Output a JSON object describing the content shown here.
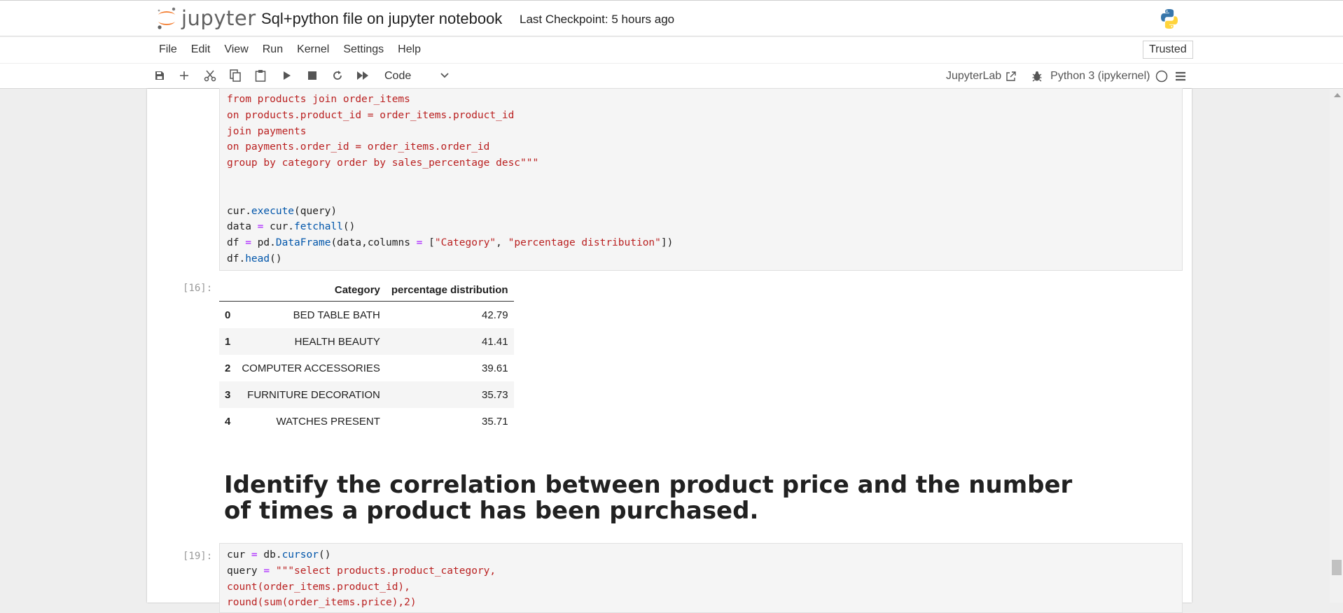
{
  "header": {
    "logo_text": "jupyter",
    "notebook_title": "Sql+python file on jupyter notebook",
    "checkpoint": "Last Checkpoint: 5 hours ago"
  },
  "menu": [
    "File",
    "Edit",
    "View",
    "Run",
    "Kernel",
    "Settings",
    "Help"
  ],
  "trusted_label": "Trusted",
  "toolbar": {
    "cell_type": "Code",
    "jupyterlab_label": "JupyterLab",
    "kernel_name": "Python 3 (ipykernel)"
  },
  "cell1": {
    "lines": [
      {
        "parts": [
          {
            "t": "from products join order_items",
            "c": "str"
          }
        ]
      },
      {
        "parts": [
          {
            "t": "on products.product_id = order_items.product_id",
            "c": "str"
          }
        ]
      },
      {
        "parts": [
          {
            "t": "join payments",
            "c": "str"
          }
        ]
      },
      {
        "parts": [
          {
            "t": "on payments.order_id = order_items.order_id",
            "c": "str"
          }
        ]
      },
      {
        "parts": [
          {
            "t": "group by category order by sales_percentage desc\"\"\"",
            "c": "str"
          }
        ]
      },
      {
        "parts": [
          {
            "t": "",
            "c": ""
          }
        ]
      },
      {
        "parts": [
          {
            "t": "",
            "c": ""
          }
        ]
      },
      {
        "parts": [
          {
            "t": "cur.",
            "c": ""
          },
          {
            "t": "execute",
            "c": "fn"
          },
          {
            "t": "(query)",
            "c": ""
          }
        ]
      },
      {
        "parts": [
          {
            "t": "data ",
            "c": ""
          },
          {
            "t": "=",
            "c": "op"
          },
          {
            "t": " cur.",
            "c": ""
          },
          {
            "t": "fetchall",
            "c": "fn"
          },
          {
            "t": "()",
            "c": ""
          }
        ]
      },
      {
        "parts": [
          {
            "t": "df ",
            "c": ""
          },
          {
            "t": "=",
            "c": "op"
          },
          {
            "t": " pd.",
            "c": ""
          },
          {
            "t": "DataFrame",
            "c": "fn"
          },
          {
            "t": "(data,columns ",
            "c": ""
          },
          {
            "t": "=",
            "c": "op"
          },
          {
            "t": " [",
            "c": ""
          },
          {
            "t": "\"Category\"",
            "c": "str"
          },
          {
            "t": ", ",
            "c": ""
          },
          {
            "t": "\"percentage distribution\"",
            "c": "str"
          },
          {
            "t": "])",
            "c": ""
          }
        ]
      },
      {
        "parts": [
          {
            "t": "df.",
            "c": ""
          },
          {
            "t": "head",
            "c": "fn"
          },
          {
            "t": "()",
            "c": ""
          }
        ]
      }
    ]
  },
  "output1": {
    "prompt": "[16]:",
    "columns": [
      "",
      "Category",
      "percentage distribution"
    ],
    "rows": [
      [
        "0",
        "BED TABLE BATH",
        "42.79"
      ],
      [
        "1",
        "HEALTH BEAUTY",
        "41.41"
      ],
      [
        "2",
        "COMPUTER ACCESSORIES",
        "39.61"
      ],
      [
        "3",
        "FURNITURE DECORATION",
        "35.73"
      ],
      [
        "4",
        "WATCHES PRESENT",
        "35.71"
      ]
    ]
  },
  "markdown_heading": "Identify the correlation between product price and the number of times a product has been purchased.",
  "cell2": {
    "prompt": "[19]:",
    "lines": [
      {
        "parts": [
          {
            "t": "cur ",
            "c": ""
          },
          {
            "t": "=",
            "c": "op"
          },
          {
            "t": " db.",
            "c": ""
          },
          {
            "t": "cursor",
            "c": "fn"
          },
          {
            "t": "()",
            "c": ""
          }
        ]
      },
      {
        "parts": [
          {
            "t": "query ",
            "c": ""
          },
          {
            "t": "=",
            "c": "op"
          },
          {
            "t": " ",
            "c": ""
          },
          {
            "t": "\"\"\"select products.product_category,",
            "c": "str"
          }
        ]
      },
      {
        "parts": [
          {
            "t": "count(order_items.product_id),",
            "c": "str"
          }
        ]
      },
      {
        "parts": [
          {
            "t": "round(sum(order_items.price),2)",
            "c": "str"
          }
        ]
      }
    ]
  }
}
